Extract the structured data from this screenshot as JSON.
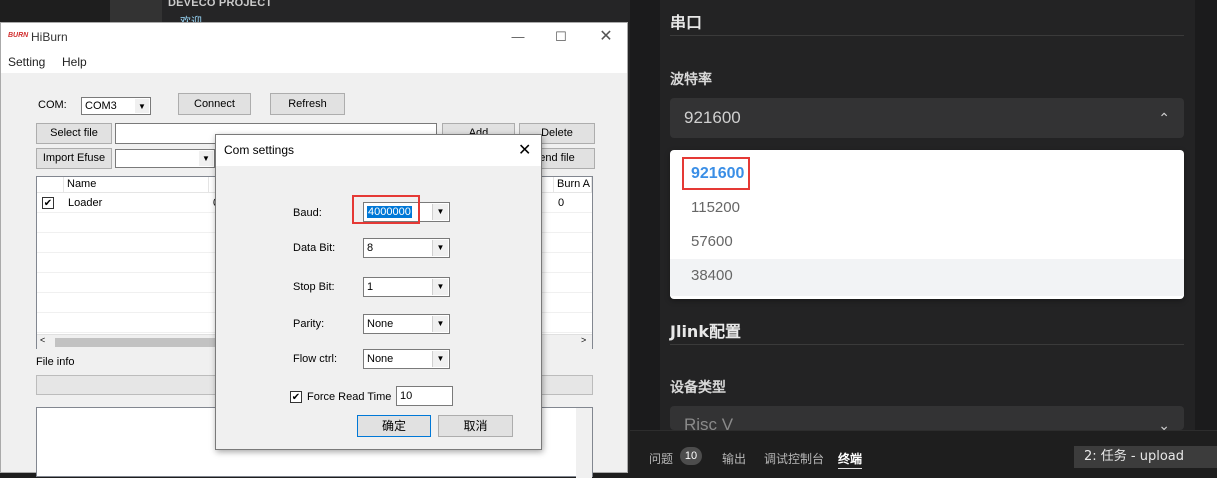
{
  "ide": {
    "project_header": "DEVECO PROJECT",
    "welcome_item": "欢迎"
  },
  "panel": {
    "serial_title": "串口",
    "baud_label": "波特率",
    "baud_value": "921600",
    "baud_options": [
      "921600",
      "115200",
      "57600",
      "38400"
    ],
    "jlink_title": "Jlink配置",
    "device_type_label": "设备类型",
    "device_type_value": "Risc V"
  },
  "bottom": {
    "tabs": [
      "问题",
      "输出",
      "调试控制台",
      "终端"
    ],
    "problems_count": "10",
    "task_label": "2: 任务 - upload"
  },
  "hiburn": {
    "logo_text": "BURN",
    "title": "HiBurn",
    "menu": [
      "Setting",
      "Help"
    ],
    "com_label": "COM:",
    "com_value": "COM3",
    "connect": "Connect",
    "refresh": "Refresh",
    "select_file": "Select file",
    "add": "Add",
    "delete": "Delete",
    "import_efuse": "Import Efuse",
    "send_file": "end file",
    "col_name": "Name",
    "col_burn": "Burn A",
    "row_name": "Loader",
    "row_burn": "0",
    "row_partial": "0",
    "file_info": "File info"
  },
  "dialog": {
    "title": "Com settings",
    "baud_label": "Baud:",
    "baud_value": "4000000",
    "databit_label": "Data Bit:",
    "databit_value": "8",
    "stopbit_label": "Stop Bit:",
    "stopbit_value": "1",
    "parity_label": "Parity:",
    "parity_value": "None",
    "flow_label": "Flow ctrl:",
    "flow_value": "None",
    "force_label": "Force Read Time",
    "force_value": "10",
    "ok": "确定",
    "cancel": "取消"
  }
}
